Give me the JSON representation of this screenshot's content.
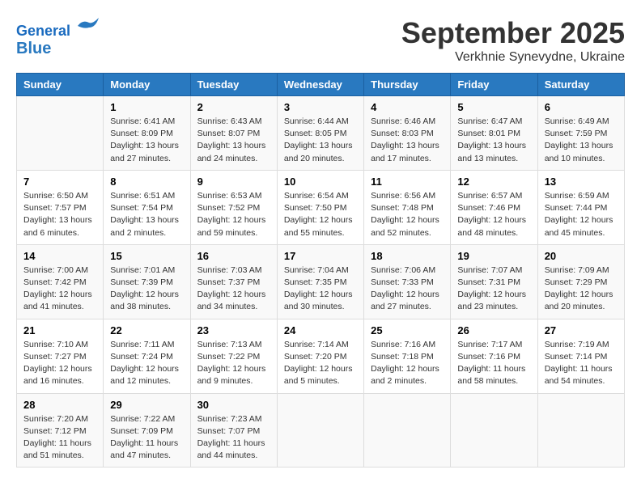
{
  "header": {
    "logo_line1": "General",
    "logo_line2": "Blue",
    "month": "September 2025",
    "location": "Verkhnie Synevydne, Ukraine"
  },
  "days_of_week": [
    "Sunday",
    "Monday",
    "Tuesday",
    "Wednesday",
    "Thursday",
    "Friday",
    "Saturday"
  ],
  "weeks": [
    [
      {
        "day": "",
        "info": ""
      },
      {
        "day": "1",
        "info": "Sunrise: 6:41 AM\nSunset: 8:09 PM\nDaylight: 13 hours and 27 minutes."
      },
      {
        "day": "2",
        "info": "Sunrise: 6:43 AM\nSunset: 8:07 PM\nDaylight: 13 hours and 24 minutes."
      },
      {
        "day": "3",
        "info": "Sunrise: 6:44 AM\nSunset: 8:05 PM\nDaylight: 13 hours and 20 minutes."
      },
      {
        "day": "4",
        "info": "Sunrise: 6:46 AM\nSunset: 8:03 PM\nDaylight: 13 hours and 17 minutes."
      },
      {
        "day": "5",
        "info": "Sunrise: 6:47 AM\nSunset: 8:01 PM\nDaylight: 13 hours and 13 minutes."
      },
      {
        "day": "6",
        "info": "Sunrise: 6:49 AM\nSunset: 7:59 PM\nDaylight: 13 hours and 10 minutes."
      }
    ],
    [
      {
        "day": "7",
        "info": "Sunrise: 6:50 AM\nSunset: 7:57 PM\nDaylight: 13 hours and 6 minutes."
      },
      {
        "day": "8",
        "info": "Sunrise: 6:51 AM\nSunset: 7:54 PM\nDaylight: 13 hours and 2 minutes."
      },
      {
        "day": "9",
        "info": "Sunrise: 6:53 AM\nSunset: 7:52 PM\nDaylight: 12 hours and 59 minutes."
      },
      {
        "day": "10",
        "info": "Sunrise: 6:54 AM\nSunset: 7:50 PM\nDaylight: 12 hours and 55 minutes."
      },
      {
        "day": "11",
        "info": "Sunrise: 6:56 AM\nSunset: 7:48 PM\nDaylight: 12 hours and 52 minutes."
      },
      {
        "day": "12",
        "info": "Sunrise: 6:57 AM\nSunset: 7:46 PM\nDaylight: 12 hours and 48 minutes."
      },
      {
        "day": "13",
        "info": "Sunrise: 6:59 AM\nSunset: 7:44 PM\nDaylight: 12 hours and 45 minutes."
      }
    ],
    [
      {
        "day": "14",
        "info": "Sunrise: 7:00 AM\nSunset: 7:42 PM\nDaylight: 12 hours and 41 minutes."
      },
      {
        "day": "15",
        "info": "Sunrise: 7:01 AM\nSunset: 7:39 PM\nDaylight: 12 hours and 38 minutes."
      },
      {
        "day": "16",
        "info": "Sunrise: 7:03 AM\nSunset: 7:37 PM\nDaylight: 12 hours and 34 minutes."
      },
      {
        "day": "17",
        "info": "Sunrise: 7:04 AM\nSunset: 7:35 PM\nDaylight: 12 hours and 30 minutes."
      },
      {
        "day": "18",
        "info": "Sunrise: 7:06 AM\nSunset: 7:33 PM\nDaylight: 12 hours and 27 minutes."
      },
      {
        "day": "19",
        "info": "Sunrise: 7:07 AM\nSunset: 7:31 PM\nDaylight: 12 hours and 23 minutes."
      },
      {
        "day": "20",
        "info": "Sunrise: 7:09 AM\nSunset: 7:29 PM\nDaylight: 12 hours and 20 minutes."
      }
    ],
    [
      {
        "day": "21",
        "info": "Sunrise: 7:10 AM\nSunset: 7:27 PM\nDaylight: 12 hours and 16 minutes."
      },
      {
        "day": "22",
        "info": "Sunrise: 7:11 AM\nSunset: 7:24 PM\nDaylight: 12 hours and 12 minutes."
      },
      {
        "day": "23",
        "info": "Sunrise: 7:13 AM\nSunset: 7:22 PM\nDaylight: 12 hours and 9 minutes."
      },
      {
        "day": "24",
        "info": "Sunrise: 7:14 AM\nSunset: 7:20 PM\nDaylight: 12 hours and 5 minutes."
      },
      {
        "day": "25",
        "info": "Sunrise: 7:16 AM\nSunset: 7:18 PM\nDaylight: 12 hours and 2 minutes."
      },
      {
        "day": "26",
        "info": "Sunrise: 7:17 AM\nSunset: 7:16 PM\nDaylight: 11 hours and 58 minutes."
      },
      {
        "day": "27",
        "info": "Sunrise: 7:19 AM\nSunset: 7:14 PM\nDaylight: 11 hours and 54 minutes."
      }
    ],
    [
      {
        "day": "28",
        "info": "Sunrise: 7:20 AM\nSunset: 7:12 PM\nDaylight: 11 hours and 51 minutes."
      },
      {
        "day": "29",
        "info": "Sunrise: 7:22 AM\nSunset: 7:09 PM\nDaylight: 11 hours and 47 minutes."
      },
      {
        "day": "30",
        "info": "Sunrise: 7:23 AM\nSunset: 7:07 PM\nDaylight: 11 hours and 44 minutes."
      },
      {
        "day": "",
        "info": ""
      },
      {
        "day": "",
        "info": ""
      },
      {
        "day": "",
        "info": ""
      },
      {
        "day": "",
        "info": ""
      }
    ]
  ]
}
